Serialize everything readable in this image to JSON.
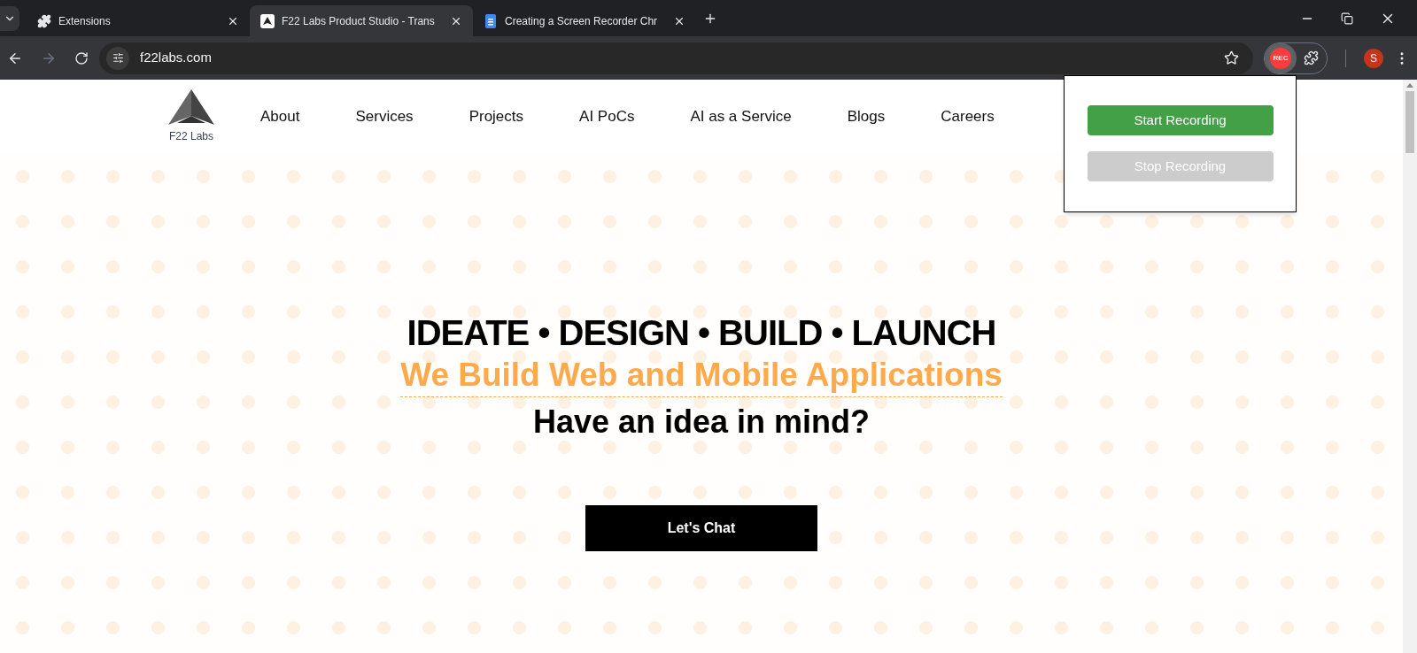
{
  "tabs": [
    {
      "title": "Extensions",
      "selected": false
    },
    {
      "title": "F22 Labs Product Studio - Trans",
      "selected": true
    },
    {
      "title": "Creating a Screen Recorder Chr",
      "selected": false
    }
  ],
  "address_bar": {
    "url": "f22labs.com"
  },
  "extension_badge": "REC",
  "profile_initial": "S",
  "site": {
    "logo_text": "F22 Labs",
    "nav": [
      "About",
      "Services",
      "Projects",
      "AI PoCs",
      "AI as a Service",
      "Blogs",
      "Careers"
    ],
    "hero": {
      "headline": "IDEATE • DESIGN • BUILD • LAUNCH",
      "subheadline": "We Build Web and Mobile Applications",
      "question": "Have an idea in mind?",
      "cta": "Let's Chat"
    }
  },
  "popup": {
    "buttons": [
      {
        "label": "Start Recording",
        "disabled": false
      },
      {
        "label": "Stop Recording",
        "disabled": true
      }
    ]
  }
}
